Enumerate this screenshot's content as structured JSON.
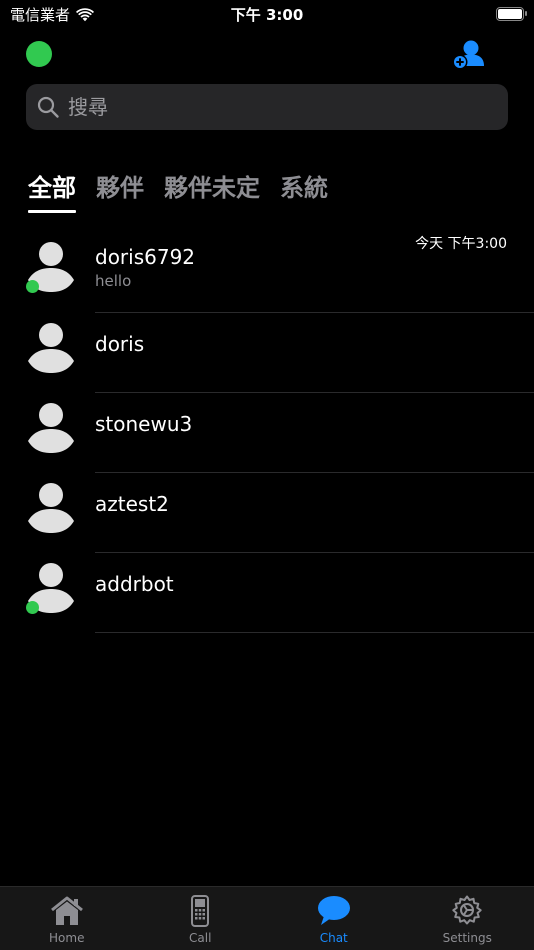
{
  "status_bar": {
    "carrier": "電信業者",
    "time": "下午 3:00"
  },
  "search": {
    "placeholder": "搜尋"
  },
  "tabs": [
    {
      "label": "全部",
      "active": true
    },
    {
      "label": "夥伴",
      "active": false
    },
    {
      "label": "夥伴未定",
      "active": false
    },
    {
      "label": "系統",
      "active": false
    }
  ],
  "contacts": [
    {
      "name": "doris6792",
      "preview": "hello",
      "time": "今天 下午3:00",
      "online": true
    },
    {
      "name": "doris",
      "preview": "",
      "time": "",
      "online": false
    },
    {
      "name": "stonewu3",
      "preview": "",
      "time": "",
      "online": false
    },
    {
      "name": "aztest2",
      "preview": "",
      "time": "",
      "online": false
    },
    {
      "name": "addrbot",
      "preview": "",
      "time": "",
      "online": true
    }
  ],
  "tabbar": [
    {
      "label": "Home",
      "icon": "home-icon",
      "active": false
    },
    {
      "label": "Call",
      "icon": "phone-icon",
      "active": false
    },
    {
      "label": "Chat",
      "icon": "chat-bubble-icon",
      "active": true
    },
    {
      "label": "Settings",
      "icon": "gear-icon",
      "active": false
    }
  ],
  "colors": {
    "accent": "#1a8cff",
    "online": "#31c950",
    "background": "#000000"
  }
}
